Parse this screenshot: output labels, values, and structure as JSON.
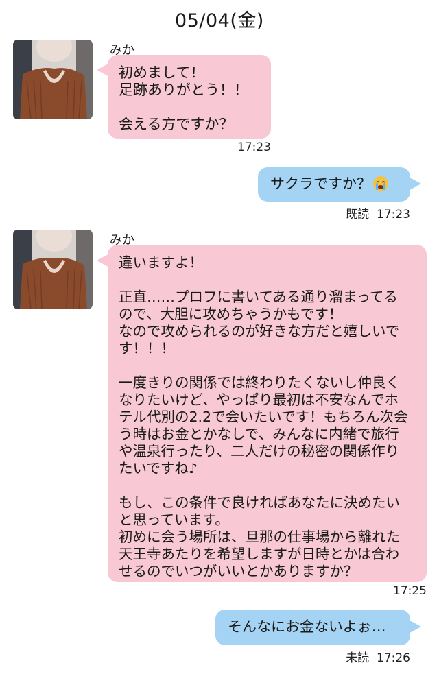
{
  "header": {
    "date": "05/04(金)"
  },
  "messages": [
    {
      "sender": "みか",
      "direction": "incoming",
      "text": "初めまして！\n足跡ありがとう！！\n\n会える方ですか？",
      "time": "17:23"
    },
    {
      "direction": "outgoing",
      "text": "サクラですか？",
      "emoji": "crying-face",
      "status": "既読",
      "time": "17:23"
    },
    {
      "sender": "みか",
      "direction": "incoming",
      "text": "違いますよ！\n\n正直……プロフに書いてある通り溜まってるので、大胆に攻めちゃうかもです！\nなので攻められるのが好きな方だと嬉しいです！！！\n\n一度きりの関係では終わりたくないし仲良くなりたいけど、やっぱり最初は不安なんでホテル代別の2.2で会いたいです！もちろん次会う時はお金とかなしで、みんなに内緒で旅行や温泉行ったり、二人だけの秘密の関係作りたいですね♪\n\nもし、この条件で良ければあなたに決めたいと思っています。\n初めに会う場所は、旦那の仕事場から離れた天王寺あたりを希望しますが日時とかは合わせるのでいつがいいとかありますか？",
      "time": "17:25"
    },
    {
      "direction": "outgoing",
      "text": "そんなにお金ないよぉ…",
      "status": "未読",
      "time": "17:26"
    }
  ],
  "colors": {
    "incoming_bubble": "#f8c9d4",
    "outgoing_bubble": "#a5d3f3",
    "background": "#ffffff"
  }
}
